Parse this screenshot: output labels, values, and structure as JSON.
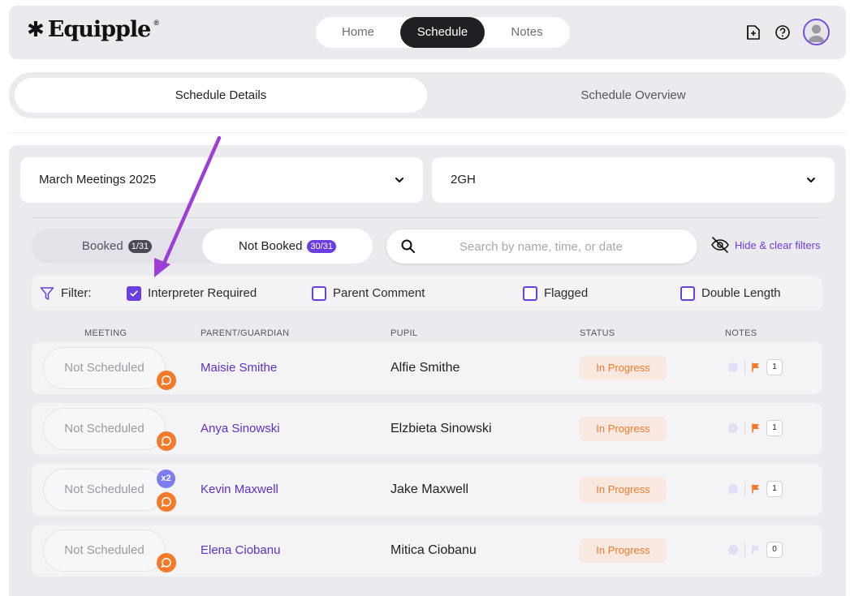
{
  "brand": {
    "logo_star": "✱",
    "logo_text": "Equipple",
    "logo_reg": "®"
  },
  "nav": {
    "home": "Home",
    "schedule": "Schedule",
    "notes": "Notes"
  },
  "top_icons": [
    "add-document-icon",
    "help-icon",
    "avatar"
  ],
  "tabs": {
    "details": "Schedule Details",
    "overview": "Schedule Overview"
  },
  "selects": {
    "meeting": "March Meetings 2025",
    "group": "2GH"
  },
  "booking": {
    "booked_label": "Booked",
    "booked_count": "1/31",
    "not_booked_label": "Not Booked",
    "not_booked_count": "30/31"
  },
  "search": {
    "placeholder": "Search by name, time, or date",
    "value": ""
  },
  "hide_filters": "Hide & clear filters",
  "filter": {
    "label": "Filter:",
    "options": [
      {
        "label": "Interpreter Required",
        "checked": true
      },
      {
        "label": "Parent Comment",
        "checked": false
      },
      {
        "label": "Flagged",
        "checked": false
      },
      {
        "label": "Double Length",
        "checked": false
      }
    ]
  },
  "columns": {
    "meeting": "MEETING",
    "parent": "PARENT/GUARDIAN",
    "pupil": "PUPIL",
    "status": "STATUS",
    "notes": "NOTES"
  },
  "rows": [
    {
      "slot": "Not Scheduled",
      "parent": "Maisie Smithe",
      "pupil": "Alfie Smithe",
      "status": "In Progress",
      "note_count": "1",
      "flagged": true,
      "double": ""
    },
    {
      "slot": "Not Scheduled",
      "parent": "Anya Sinowski",
      "pupil": "Elzbieta Sinowski",
      "status": "In Progress",
      "note_count": "1",
      "flagged": true,
      "double": ""
    },
    {
      "slot": "Not Scheduled",
      "parent": "Kevin Maxwell",
      "pupil": "Jake Maxwell",
      "status": "In Progress",
      "note_count": "1",
      "flagged": true,
      "double": "x2"
    },
    {
      "slot": "Not Scheduled",
      "parent": "Elena Ciobanu",
      "pupil": "Mitica Ciobanu",
      "status": "In Progress",
      "note_count": "0",
      "flagged": false,
      "double": ""
    }
  ],
  "colors": {
    "accent": "#6a3ee0",
    "orange": "#f47a2a",
    "arrow": "#9b3fd6"
  }
}
